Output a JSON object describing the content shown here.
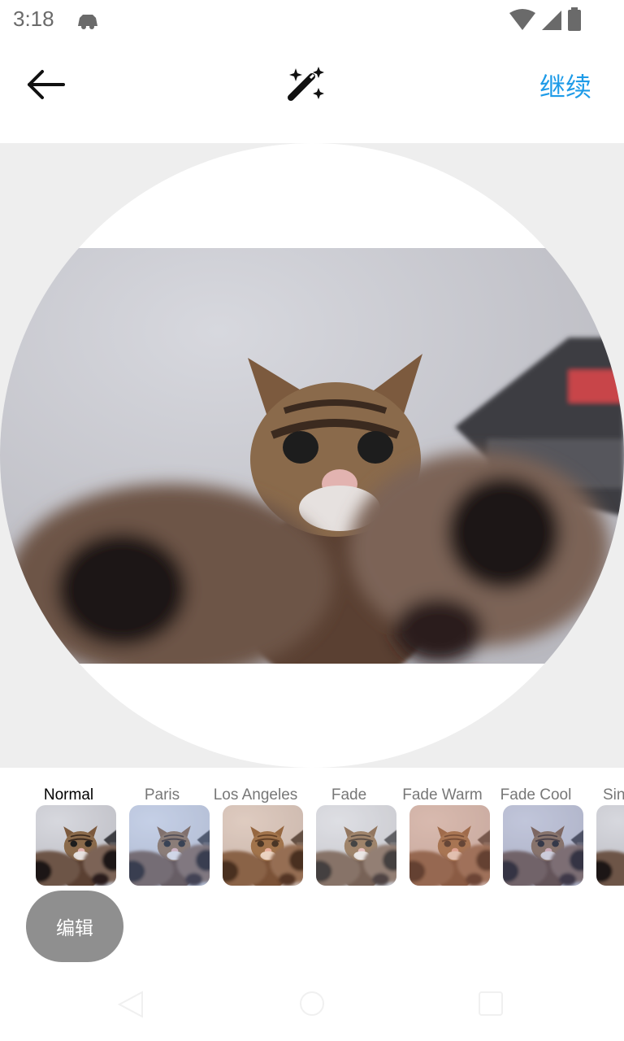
{
  "status_bar": {
    "time": "3:18"
  },
  "header": {
    "continue_label": "继续"
  },
  "filters": [
    {
      "label": "Normal",
      "active": true,
      "tint": "#00000000"
    },
    {
      "label": "Paris",
      "active": false,
      "tint": "#8fb7ff40"
    },
    {
      "label": "Los Angeles",
      "active": false,
      "tint": "#ff9a4a35"
    },
    {
      "label": "Fade",
      "active": false,
      "tint": "#ffffff30"
    },
    {
      "label": "Fade Warm",
      "active": false,
      "tint": "#d98a6060"
    },
    {
      "label": "Fade Cool",
      "active": false,
      "tint": "#7f8fd040"
    },
    {
      "label": "Sin",
      "active": false,
      "tint": "#00000000"
    }
  ],
  "edit_button": {
    "label": "编辑"
  },
  "colors": {
    "accent": "#1e9be8",
    "canvas_bg": "#eeeeee",
    "edit_button_bg": "#8f8f8f"
  }
}
